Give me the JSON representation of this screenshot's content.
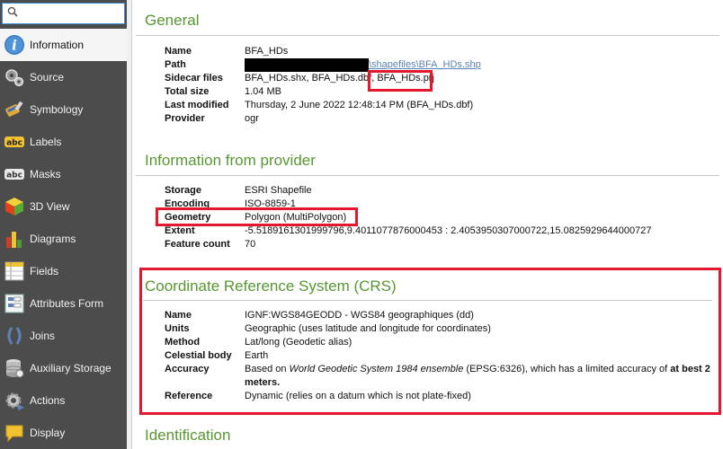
{
  "search": {
    "value": "",
    "placeholder": ""
  },
  "sidebar": {
    "items": [
      {
        "label": "Information",
        "icon": "info-icon",
        "active": true
      },
      {
        "label": "Source",
        "icon": "source-icon"
      },
      {
        "label": "Symbology",
        "icon": "symbology-icon"
      },
      {
        "label": "Labels",
        "icon": "labels-icon"
      },
      {
        "label": "Masks",
        "icon": "masks-icon"
      },
      {
        "label": "3D View",
        "icon": "3d-view-icon"
      },
      {
        "label": "Diagrams",
        "icon": "diagrams-icon"
      },
      {
        "label": "Fields",
        "icon": "fields-icon"
      },
      {
        "label": "Attributes Form",
        "icon": "attributes-form-icon"
      },
      {
        "label": "Joins",
        "icon": "joins-icon"
      },
      {
        "label": "Auxiliary Storage",
        "icon": "auxiliary-storage-icon"
      },
      {
        "label": "Actions",
        "icon": "actions-icon"
      },
      {
        "label": "Display",
        "icon": "display-icon"
      }
    ]
  },
  "general": {
    "title": "General",
    "name_label": "Name",
    "name_value": "BFA_HDs",
    "path_label": "Path",
    "path_value": "\\shapefiles\\BFA_HDs.shp",
    "sidecar_label": "Sidecar files",
    "sidecar_value": "BFA_HDs.shx, BFA_HDs.dbf,",
    "sidecar_highlight": "BFA_HDs.prj",
    "size_label": "Total size",
    "size_value": "1.04 MB",
    "modified_label": "Last modified",
    "modified_value": "Thursday, 2 June 2022 12:48:14 PM (BFA_HDs.dbf)",
    "provider_label": "Provider",
    "provider_value": "ogr"
  },
  "provider_info": {
    "title": "Information from provider",
    "storage_label": "Storage",
    "storage_value": "ESRI Shapefile",
    "encoding_label": "Encoding",
    "encoding_value": "ISO-8859-1",
    "geometry_label": "Geometry",
    "geometry_value": "Polygon (MultiPolygon)",
    "extent_label": "Extent",
    "extent_value": "-5.5189161301999796,9.4011077876000453 : 2.4053950307000722,15.0825929644000727",
    "feature_count_label": "Feature count",
    "feature_count_value": "70"
  },
  "crs": {
    "title": "Coordinate Reference System (CRS)",
    "name_label": "Name",
    "name_value": "IGNF:WGS84GEODD - WGS84 geographiques (dd)",
    "units_label": "Units",
    "units_value": "Geographic (uses latitude and longitude for coordinates)",
    "method_label": "Method",
    "method_value": "Lat/long (Geodetic alias)",
    "body_label": "Celestial body",
    "body_value": "Earth",
    "accuracy_label": "Accuracy",
    "accuracy_pre": "Based on ",
    "accuracy_italic": "World Geodetic System 1984 ensemble",
    "accuracy_mid": " (EPSG:6326), which has a limited accuracy of ",
    "accuracy_bold1": "at best 2",
    "accuracy_bold2": "meters.",
    "reference_label": "Reference",
    "reference_value": "Dynamic (relies on a datum which is not plate-fixed)"
  },
  "identification": {
    "title": "Identification"
  },
  "colors": {
    "accent_green": "#589632",
    "highlight_red": "#e3172d",
    "sidebar_bg": "#4c4c4c",
    "link_blue": "#5b83b8"
  }
}
